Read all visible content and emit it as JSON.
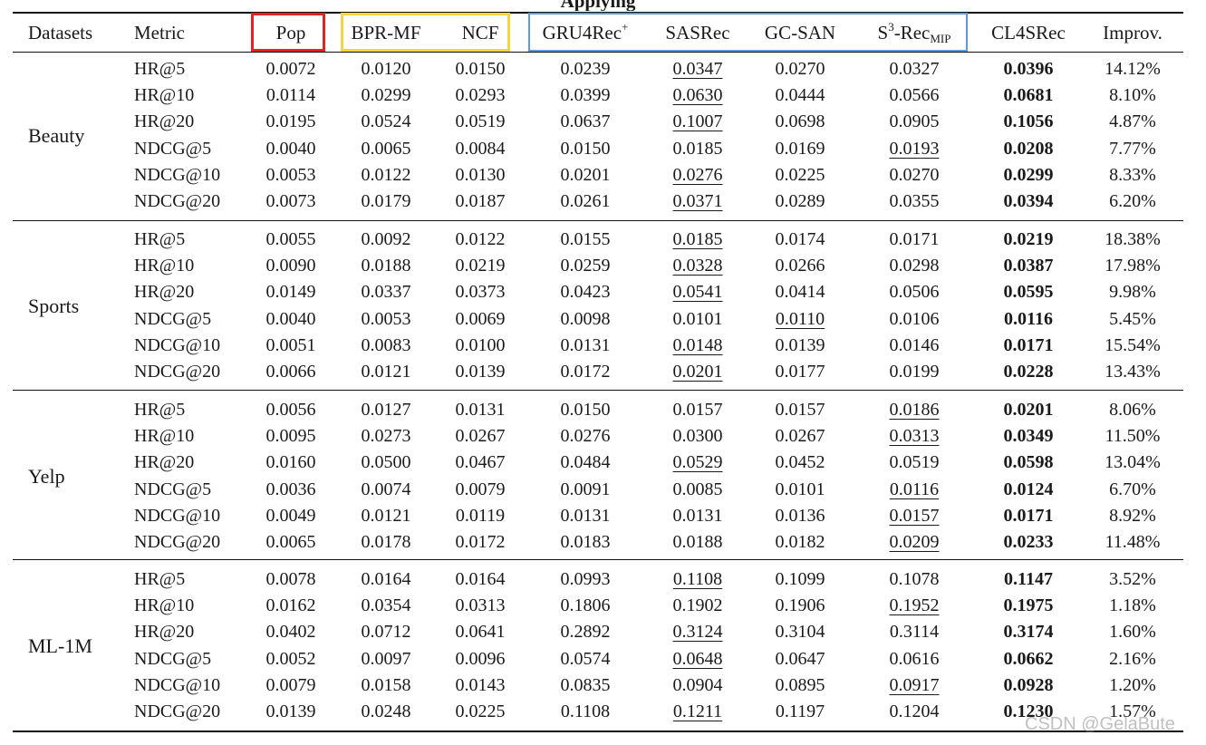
{
  "caption_fragment": "Applying",
  "header": {
    "datasets": "Datasets",
    "metric": "Metric",
    "pop": "Pop",
    "bpr_mf": "BPR-MF",
    "ncf": "NCF",
    "gru4rec": "GRU4Rec",
    "gru4rec_sup": "+",
    "sasrec": "SASRec",
    "gc_san": "GC-SAN",
    "s3_base": "S",
    "s3_sup": "3",
    "s3_rest": "-Rec",
    "s3_sub": "MIP",
    "cl4srec": "CL4SRec",
    "improv": "Improv."
  },
  "highlight_colors": {
    "pop_box": "#e8201f",
    "matrix_factorization_box": "#f5d63a",
    "sequential_box": "#5b9bdc"
  },
  "groups": [
    {
      "name": "Beauty",
      "rows": [
        {
          "metric": "HR@5",
          "values": [
            "0.0072",
            "0.0120",
            "0.0150",
            "0.0239",
            "0.0347",
            "0.0270",
            "0.0327",
            "0.0396"
          ],
          "improv": "14.12%",
          "second": 4
        },
        {
          "metric": "HR@10",
          "values": [
            "0.0114",
            "0.0299",
            "0.0293",
            "0.0399",
            "0.0630",
            "0.0444",
            "0.0566",
            "0.0681"
          ],
          "improv": "8.10%",
          "second": 4
        },
        {
          "metric": "HR@20",
          "values": [
            "0.0195",
            "0.0524",
            "0.0519",
            "0.0637",
            "0.1007",
            "0.0698",
            "0.0905",
            "0.1056"
          ],
          "improv": "4.87%",
          "second": 4
        },
        {
          "metric": "NDCG@5",
          "values": [
            "0.0040",
            "0.0065",
            "0.0084",
            "0.0150",
            "0.0185",
            "0.0169",
            "0.0193",
            "0.0208"
          ],
          "improv": "7.77%",
          "second": 6
        },
        {
          "metric": "NDCG@10",
          "values": [
            "0.0053",
            "0.0122",
            "0.0130",
            "0.0201",
            "0.0276",
            "0.0225",
            "0.0270",
            "0.0299"
          ],
          "improv": "8.33%",
          "second": 4
        },
        {
          "metric": "NDCG@20",
          "values": [
            "0.0073",
            "0.0179",
            "0.0187",
            "0.0261",
            "0.0371",
            "0.0289",
            "0.0355",
            "0.0394"
          ],
          "improv": "6.20%",
          "second": 4
        }
      ]
    },
    {
      "name": "Sports",
      "rows": [
        {
          "metric": "HR@5",
          "values": [
            "0.0055",
            "0.0092",
            "0.0122",
            "0.0155",
            "0.0185",
            "0.0174",
            "0.0171",
            "0.0219"
          ],
          "improv": "18.38%",
          "second": 4
        },
        {
          "metric": "HR@10",
          "values": [
            "0.0090",
            "0.0188",
            "0.0219",
            "0.0259",
            "0.0328",
            "0.0266",
            "0.0298",
            "0.0387"
          ],
          "improv": "17.98%",
          "second": 4
        },
        {
          "metric": "HR@20",
          "values": [
            "0.0149",
            "0.0337",
            "0.0373",
            "0.0423",
            "0.0541",
            "0.0414",
            "0.0506",
            "0.0595"
          ],
          "improv": "9.98%",
          "second": 4
        },
        {
          "metric": "NDCG@5",
          "values": [
            "0.0040",
            "0.0053",
            "0.0069",
            "0.0098",
            "0.0101",
            "0.0110",
            "0.0106",
            "0.0116"
          ],
          "improv": "5.45%",
          "second": 5
        },
        {
          "metric": "NDCG@10",
          "values": [
            "0.0051",
            "0.0083",
            "0.0100",
            "0.0131",
            "0.0148",
            "0.0139",
            "0.0146",
            "0.0171"
          ],
          "improv": "15.54%",
          "second": 4
        },
        {
          "metric": "NDCG@20",
          "values": [
            "0.0066",
            "0.0121",
            "0.0139",
            "0.0172",
            "0.0201",
            "0.0177",
            "0.0199",
            "0.0228"
          ],
          "improv": "13.43%",
          "second": 4
        }
      ]
    },
    {
      "name": "Yelp",
      "rows": [
        {
          "metric": "HR@5",
          "values": [
            "0.0056",
            "0.0127",
            "0.0131",
            "0.0150",
            "0.0157",
            "0.0157",
            "0.0186",
            "0.0201"
          ],
          "improv": "8.06%",
          "second": 6
        },
        {
          "metric": "HR@10",
          "values": [
            "0.0095",
            "0.0273",
            "0.0267",
            "0.0276",
            "0.0300",
            "0.0267",
            "0.0313",
            "0.0349"
          ],
          "improv": "11.50%",
          "second": 6
        },
        {
          "metric": "HR@20",
          "values": [
            "0.0160",
            "0.0500",
            "0.0467",
            "0.0484",
            "0.0529",
            "0.0452",
            "0.0519",
            "0.0598"
          ],
          "improv": "13.04%",
          "second": 4
        },
        {
          "metric": "NDCG@5",
          "values": [
            "0.0036",
            "0.0074",
            "0.0079",
            "0.0091",
            "0.0085",
            "0.0101",
            "0.0116",
            "0.0124"
          ],
          "improv": "6.70%",
          "second": 6
        },
        {
          "metric": "NDCG@10",
          "values": [
            "0.0049",
            "0.0121",
            "0.0119",
            "0.0131",
            "0.0131",
            "0.0136",
            "0.0157",
            "0.0171"
          ],
          "improv": "8.92%",
          "second": 6
        },
        {
          "metric": "NDCG@20",
          "values": [
            "0.0065",
            "0.0178",
            "0.0172",
            "0.0183",
            "0.0188",
            "0.0182",
            "0.0209",
            "0.0233"
          ],
          "improv": "11.48%",
          "second": 6
        }
      ]
    },
    {
      "name": "ML-1M",
      "rows": [
        {
          "metric": "HR@5",
          "values": [
            "0.0078",
            "0.0164",
            "0.0164",
            "0.0993",
            "0.1108",
            "0.1099",
            "0.1078",
            "0.1147"
          ],
          "improv": "3.52%",
          "second": 4
        },
        {
          "metric": "HR@10",
          "values": [
            "0.0162",
            "0.0354",
            "0.0313",
            "0.1806",
            "0.1902",
            "0.1906",
            "0.1952",
            "0.1975"
          ],
          "improv": "1.18%",
          "second": 6
        },
        {
          "metric": "HR@20",
          "values": [
            "0.0402",
            "0.0712",
            "0.0641",
            "0.2892",
            "0.3124",
            "0.3104",
            "0.3114",
            "0.3174"
          ],
          "improv": "1.60%",
          "second": 4
        },
        {
          "metric": "NDCG@5",
          "values": [
            "0.0052",
            "0.0097",
            "0.0096",
            "0.0574",
            "0.0648",
            "0.0647",
            "0.0616",
            "0.0662"
          ],
          "improv": "2.16%",
          "second": 4
        },
        {
          "metric": "NDCG@10",
          "values": [
            "0.0079",
            "0.0158",
            "0.0143",
            "0.0835",
            "0.0904",
            "0.0895",
            "0.0917",
            "0.0928"
          ],
          "improv": "1.20%",
          "second": 6
        },
        {
          "metric": "NDCG@20",
          "values": [
            "0.0139",
            "0.0248",
            "0.0225",
            "0.1108",
            "0.1211",
            "0.1197",
            "0.1204",
            "0.1230"
          ],
          "improv": "1.57%",
          "second": 4
        }
      ]
    }
  ],
  "watermark": "CSDN @GelaBute"
}
